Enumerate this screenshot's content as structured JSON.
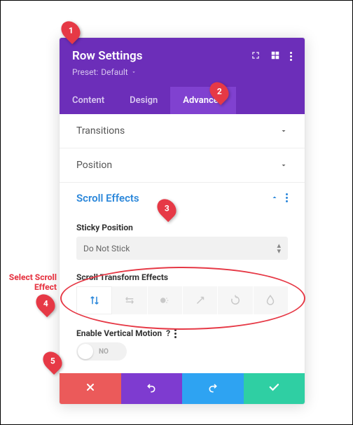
{
  "header": {
    "title": "Row Settings",
    "preset_prefix": "Preset:",
    "preset_value": "Default"
  },
  "tabs": {
    "content": "Content",
    "design": "Design",
    "advanced": "Advanced"
  },
  "accordion": {
    "transitions": "Transitions",
    "position": "Position",
    "scroll_effects": "Scroll Effects"
  },
  "fields": {
    "sticky_position_label": "Sticky Position",
    "sticky_position_value": "Do Not Stick",
    "transform_label": "Scroll Transform Effects",
    "enable_vertical_label": "Enable Vertical Motion",
    "toggle_no": "NO"
  },
  "annotations": {
    "c1": "1",
    "c2": "2",
    "c3": "3",
    "c4": "4",
    "c5": "5",
    "select_label": "Select Scroll\nEffect"
  },
  "colors": {
    "brand": "#6c2eb9",
    "accent": "#2b87da",
    "danger": "#e63946"
  }
}
